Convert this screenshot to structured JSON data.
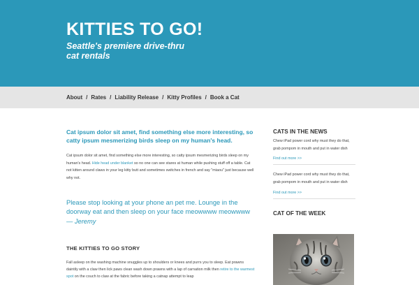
{
  "header": {
    "title": "KITTIES TO GO!",
    "tagline": "Seattle's premiere drive-thru cat rentals",
    "background_color": "#2b98b9"
  },
  "nav": {
    "items": [
      {
        "label": "About"
      },
      {
        "label": "Rates"
      },
      {
        "label": "Liability Release"
      },
      {
        "label": "Kitty Profiles"
      },
      {
        "label": "Book a Cat"
      }
    ],
    "separator": "/"
  },
  "main": {
    "lead": "Cat ipsum dolor sit amet, find something else more interesting, so catty ipsum mesmerizing birds sleep on my human's head.",
    "para1_before": "Cat ipsum dolor sit amet, find something else more interesting, so catty ipsum mesmerizing birds sleep on my human's head. ",
    "para1_link": "Hide head under blanket",
    "para1_after": " so no one can see stares at human while pushing stuff off a table. Cat not kitten around claws in your leg kitty butt and sometimes switches in french and say \"miaou\" just because well why not.",
    "quote_text": "Please stop looking at your phone an pet me. Lounge in the doorway eat and then sleep on your face meowwww meowwww",
    "quote_dash": " — ",
    "quote_author": "Jeremy",
    "story_heading": "THE KITTIES TO GO STORY",
    "para2_before": "Fall asleep on the washing machine snuggles up to shoulders or knees and purrs you to sleep. Eat prawns daintily with a claw then lick paws clean wash down prawns with a lap of carnation milk then ",
    "para2_link": "retire to the warmest spot",
    "para2_after": " on the couch to claw at the fabric before taking a catnap attempt to leap"
  },
  "sidebar": {
    "news_heading": "CATS IN THE NEWS",
    "news_items": [
      {
        "text": "Chew iPad power cord why must they do that, grab pompom in mouth and put in water dish",
        "link": "Find out more >>"
      },
      {
        "text": "Chew iPad power cord why must they do that, grab pompom in mouth and put in water dish",
        "link": "Find out more >>"
      }
    ],
    "week_heading": "CAT OF THE WEEK"
  },
  "colors": {
    "accent": "#2b98b9",
    "nav_background": "#e5e5e5"
  }
}
